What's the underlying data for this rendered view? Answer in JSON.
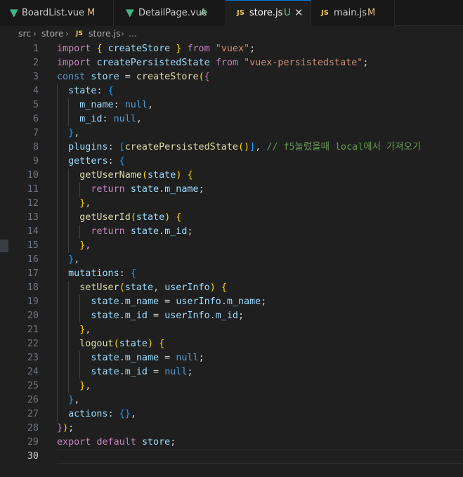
{
  "tabs": [
    {
      "label": "BoardList.vue",
      "status": "M",
      "icon": "vue",
      "active": false
    },
    {
      "label": "DetailPage.vue",
      "status": "A",
      "icon": "vue",
      "active": false
    },
    {
      "label": "store.js",
      "status": "U",
      "icon": "JS",
      "active": true
    },
    {
      "label": "main.js",
      "status": "M",
      "icon": "JS",
      "active": false
    }
  ],
  "breadcrumb": {
    "items": [
      "src",
      "store",
      "store.js",
      "..."
    ],
    "file_icon": "JS"
  },
  "editor": {
    "current_line": 30,
    "lines": [
      [
        [
          "kw",
          "import"
        ],
        [
          "p",
          " "
        ],
        [
          "b1",
          "{"
        ],
        [
          "p",
          " "
        ],
        [
          "var",
          "createStore"
        ],
        [
          "p",
          " "
        ],
        [
          "b1",
          "}"
        ],
        [
          "p",
          " "
        ],
        [
          "kw",
          "from"
        ],
        [
          "p",
          " "
        ],
        [
          "str",
          "\"vuex\""
        ],
        [
          "p",
          ";"
        ]
      ],
      [
        [
          "kw",
          "import"
        ],
        [
          "p",
          " "
        ],
        [
          "var",
          "createPersistedState"
        ],
        [
          "p",
          " "
        ],
        [
          "kw",
          "from"
        ],
        [
          "p",
          " "
        ],
        [
          "str",
          "\"vuex-persistedstate\""
        ],
        [
          "p",
          ";"
        ]
      ],
      [
        [
          "dcl",
          "const"
        ],
        [
          "p",
          " "
        ],
        [
          "var",
          "store"
        ],
        [
          "p",
          " = "
        ],
        [
          "fn",
          "createStore"
        ],
        [
          "b1",
          "("
        ],
        [
          "b2",
          "{"
        ]
      ],
      [
        [
          "p",
          "  "
        ],
        [
          "var",
          "state"
        ],
        [
          "p",
          ": "
        ],
        [
          "b3",
          "{"
        ]
      ],
      [
        [
          "p",
          "    "
        ],
        [
          "var",
          "m_name"
        ],
        [
          "p",
          ": "
        ],
        [
          "nul",
          "null"
        ],
        [
          "p",
          ","
        ]
      ],
      [
        [
          "p",
          "    "
        ],
        [
          "var",
          "m_id"
        ],
        [
          "p",
          ": "
        ],
        [
          "nul",
          "null"
        ],
        [
          "p",
          ","
        ]
      ],
      [
        [
          "p",
          "  "
        ],
        [
          "b3",
          "}"
        ],
        [
          "p",
          ","
        ]
      ],
      [
        [
          "p",
          "  "
        ],
        [
          "var",
          "plugins"
        ],
        [
          "p",
          ": "
        ],
        [
          "b3",
          "["
        ],
        [
          "fn",
          "createPersistedState"
        ],
        [
          "b1",
          "()"
        ],
        [
          "b3",
          "]"
        ],
        [
          "p",
          ", "
        ],
        [
          "cm",
          "// f5눌렀을때 local에서 가져오기"
        ]
      ],
      [
        [
          "p",
          "  "
        ],
        [
          "var",
          "getters"
        ],
        [
          "p",
          ": "
        ],
        [
          "b3",
          "{"
        ]
      ],
      [
        [
          "p",
          "    "
        ],
        [
          "fn",
          "getUserName"
        ],
        [
          "b1",
          "("
        ],
        [
          "var",
          "state"
        ],
        [
          "b1",
          ")"
        ],
        [
          "p",
          " "
        ],
        [
          "b1",
          "{"
        ]
      ],
      [
        [
          "p",
          "      "
        ],
        [
          "kw",
          "return"
        ],
        [
          "p",
          " "
        ],
        [
          "var",
          "state"
        ],
        [
          "p",
          "."
        ],
        [
          "var",
          "m_name"
        ],
        [
          "p",
          ";"
        ]
      ],
      [
        [
          "p",
          "    "
        ],
        [
          "b1",
          "}"
        ],
        [
          "p",
          ","
        ]
      ],
      [
        [
          "p",
          "    "
        ],
        [
          "fn",
          "getUserId"
        ],
        [
          "b1",
          "("
        ],
        [
          "var",
          "state"
        ],
        [
          "b1",
          ")"
        ],
        [
          "p",
          " "
        ],
        [
          "b1",
          "{"
        ]
      ],
      [
        [
          "p",
          "      "
        ],
        [
          "kw",
          "return"
        ],
        [
          "p",
          " "
        ],
        [
          "var",
          "state"
        ],
        [
          "p",
          "."
        ],
        [
          "var",
          "m_id"
        ],
        [
          "p",
          ";"
        ]
      ],
      [
        [
          "p",
          "    "
        ],
        [
          "b1",
          "}"
        ],
        [
          "p",
          ","
        ]
      ],
      [
        [
          "p",
          "  "
        ],
        [
          "b3",
          "}"
        ],
        [
          "p",
          ","
        ]
      ],
      [
        [
          "p",
          "  "
        ],
        [
          "var",
          "mutations"
        ],
        [
          "p",
          ": "
        ],
        [
          "b3",
          "{"
        ]
      ],
      [
        [
          "p",
          "    "
        ],
        [
          "fn",
          "setUser"
        ],
        [
          "b1",
          "("
        ],
        [
          "var",
          "state"
        ],
        [
          "p",
          ", "
        ],
        [
          "var",
          "userInfo"
        ],
        [
          "b1",
          ")"
        ],
        [
          "p",
          " "
        ],
        [
          "b1",
          "{"
        ]
      ],
      [
        [
          "p",
          "      "
        ],
        [
          "var",
          "state"
        ],
        [
          "p",
          "."
        ],
        [
          "var",
          "m_name"
        ],
        [
          "p",
          " = "
        ],
        [
          "var",
          "userInfo"
        ],
        [
          "p",
          "."
        ],
        [
          "var",
          "m_name"
        ],
        [
          "p",
          ";"
        ]
      ],
      [
        [
          "p",
          "      "
        ],
        [
          "var",
          "state"
        ],
        [
          "p",
          "."
        ],
        [
          "var",
          "m_id"
        ],
        [
          "p",
          " = "
        ],
        [
          "var",
          "userInfo"
        ],
        [
          "p",
          "."
        ],
        [
          "var",
          "m_id"
        ],
        [
          "p",
          ";"
        ]
      ],
      [
        [
          "p",
          "    "
        ],
        [
          "b1",
          "}"
        ],
        [
          "p",
          ","
        ]
      ],
      [
        [
          "p",
          "    "
        ],
        [
          "fn",
          "logout"
        ],
        [
          "b1",
          "("
        ],
        [
          "var",
          "state"
        ],
        [
          "b1",
          ")"
        ],
        [
          "p",
          " "
        ],
        [
          "b1",
          "{"
        ]
      ],
      [
        [
          "p",
          "      "
        ],
        [
          "var",
          "state"
        ],
        [
          "p",
          "."
        ],
        [
          "var",
          "m_name"
        ],
        [
          "p",
          " = "
        ],
        [
          "nul",
          "null"
        ],
        [
          "p",
          ";"
        ]
      ],
      [
        [
          "p",
          "      "
        ],
        [
          "var",
          "state"
        ],
        [
          "p",
          "."
        ],
        [
          "var",
          "m_id"
        ],
        [
          "p",
          " = "
        ],
        [
          "nul",
          "null"
        ],
        [
          "p",
          ";"
        ]
      ],
      [
        [
          "p",
          "    "
        ],
        [
          "b1",
          "}"
        ],
        [
          "p",
          ","
        ]
      ],
      [
        [
          "p",
          "  "
        ],
        [
          "b3",
          "}"
        ],
        [
          "p",
          ","
        ]
      ],
      [
        [
          "p",
          "  "
        ],
        [
          "var",
          "actions"
        ],
        [
          "p",
          ": "
        ],
        [
          "b3",
          "{}"
        ],
        [
          "p",
          ","
        ]
      ],
      [
        [
          "b2",
          "}"
        ],
        [
          "b1",
          ")"
        ],
        [
          "p",
          ";"
        ]
      ],
      [
        [
          "kw",
          "export"
        ],
        [
          "p",
          " "
        ],
        [
          "kw",
          "default"
        ],
        [
          "p",
          " "
        ],
        [
          "var",
          "store"
        ],
        [
          "p",
          ";"
        ]
      ],
      []
    ]
  },
  "colors": {
    "background": "#1f1f1f",
    "tab_bar": "#181818",
    "accent": "#0078d4",
    "modified": "#e2c08d",
    "added": "#73c991",
    "vue_icon": "#41b883",
    "js_icon": "#e8c84f"
  }
}
